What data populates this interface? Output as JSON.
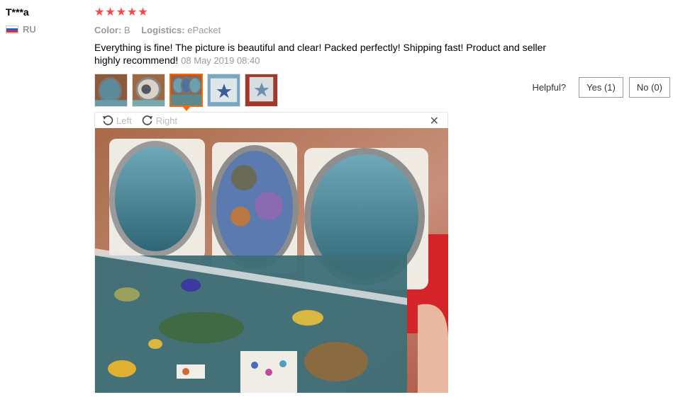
{
  "user": {
    "name": "T***a",
    "country": "RU"
  },
  "review": {
    "stars": "★★★★★",
    "rating": 5,
    "color_label": "Color:",
    "color_value": "B",
    "logistics_label": "Logistics:",
    "logistics_value": "ePacket",
    "text": "Everything is fine! The picture is beautiful and clear! Packed perfectly! Shipping fast! Product and seller highly recommend!",
    "date": "08 May 2019 08:40"
  },
  "helpful": {
    "label": "Helpful?",
    "yes": "Yes (1)",
    "no": "No (0)"
  },
  "viewer": {
    "left_label": "Left",
    "right_label": "Right"
  },
  "colors": {
    "star": "#ff4747",
    "active_border": "#ff6600"
  }
}
